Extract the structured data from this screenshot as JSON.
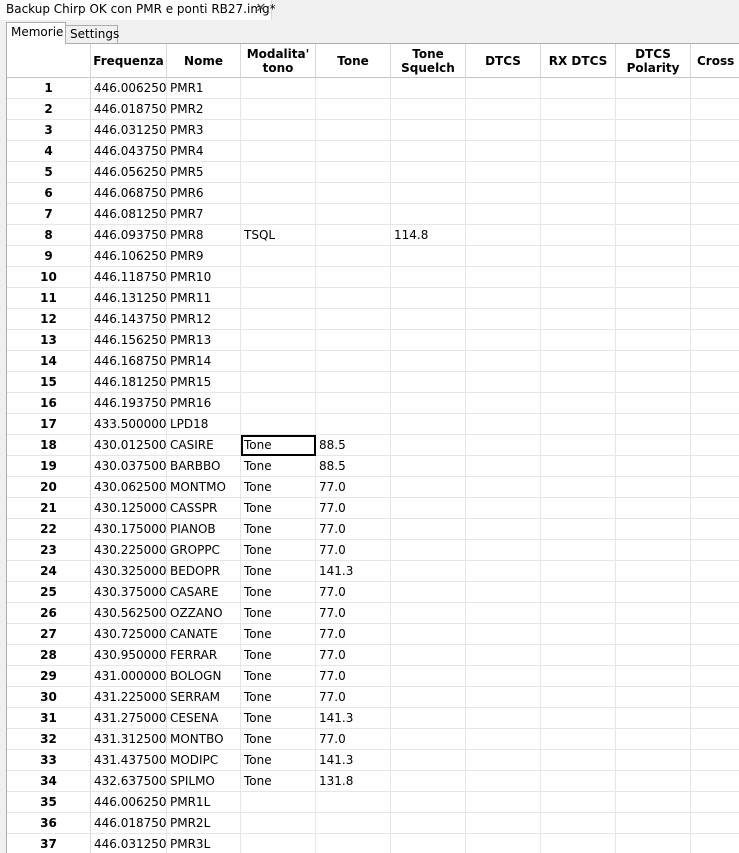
{
  "window": {
    "file_tab_title": "Backup Chirp OK con PMR e ponti RB27.img*",
    "close_glyph": "✕"
  },
  "subtabs": {
    "memories": "Memorie",
    "settings": "Settings"
  },
  "table": {
    "columns": [
      "Frequenza",
      "Nome",
      "Modalita'\ntono",
      "Tone",
      "Tone\nSquelch",
      "DTCS",
      "RX DTCS",
      "DTCS\nPolarity",
      "Cross mode"
    ],
    "selected_row": 18,
    "selected_col": 2,
    "rows": [
      {
        "n": "1",
        "freq": "446.006250",
        "name": "PMR1",
        "mode": "",
        "tone": "",
        "tsql": ""
      },
      {
        "n": "2",
        "freq": "446.018750",
        "name": "PMR2",
        "mode": "",
        "tone": "",
        "tsql": ""
      },
      {
        "n": "3",
        "freq": "446.031250",
        "name": "PMR3",
        "mode": "",
        "tone": "",
        "tsql": ""
      },
      {
        "n": "4",
        "freq": "446.043750",
        "name": "PMR4",
        "mode": "",
        "tone": "",
        "tsql": ""
      },
      {
        "n": "5",
        "freq": "446.056250",
        "name": "PMR5",
        "mode": "",
        "tone": "",
        "tsql": ""
      },
      {
        "n": "6",
        "freq": "446.068750",
        "name": "PMR6",
        "mode": "",
        "tone": "",
        "tsql": ""
      },
      {
        "n": "7",
        "freq": "446.081250",
        "name": "PMR7",
        "mode": "",
        "tone": "",
        "tsql": ""
      },
      {
        "n": "8",
        "freq": "446.093750",
        "name": "PMR8",
        "mode": "TSQL",
        "tone": "",
        "tsql": "114.8"
      },
      {
        "n": "9",
        "freq": "446.106250",
        "name": "PMR9",
        "mode": "",
        "tone": "",
        "tsql": ""
      },
      {
        "n": "10",
        "freq": "446.118750",
        "name": "PMR10",
        "mode": "",
        "tone": "",
        "tsql": ""
      },
      {
        "n": "11",
        "freq": "446.131250",
        "name": "PMR11",
        "mode": "",
        "tone": "",
        "tsql": ""
      },
      {
        "n": "12",
        "freq": "446.143750",
        "name": "PMR12",
        "mode": "",
        "tone": "",
        "tsql": ""
      },
      {
        "n": "13",
        "freq": "446.156250",
        "name": "PMR13",
        "mode": "",
        "tone": "",
        "tsql": ""
      },
      {
        "n": "14",
        "freq": "446.168750",
        "name": "PMR14",
        "mode": "",
        "tone": "",
        "tsql": ""
      },
      {
        "n": "15",
        "freq": "446.181250",
        "name": "PMR15",
        "mode": "",
        "tone": "",
        "tsql": ""
      },
      {
        "n": "16",
        "freq": "446.193750",
        "name": "PMR16",
        "mode": "",
        "tone": "",
        "tsql": ""
      },
      {
        "n": "17",
        "freq": "433.500000",
        "name": "LPD18",
        "mode": "",
        "tone": "",
        "tsql": ""
      },
      {
        "n": "18",
        "freq": "430.012500",
        "name": "CASIRE",
        "mode": "Tone",
        "tone": "88.5",
        "tsql": ""
      },
      {
        "n": "19",
        "freq": "430.037500",
        "name": "BARBBO",
        "mode": "Tone",
        "tone": "88.5",
        "tsql": ""
      },
      {
        "n": "20",
        "freq": "430.062500",
        "name": "MONTMO",
        "mode": "Tone",
        "tone": "77.0",
        "tsql": ""
      },
      {
        "n": "21",
        "freq": "430.125000",
        "name": "CASSPR",
        "mode": "Tone",
        "tone": "77.0",
        "tsql": ""
      },
      {
        "n": "22",
        "freq": "430.175000",
        "name": "PIANOB",
        "mode": "Tone",
        "tone": "77.0",
        "tsql": ""
      },
      {
        "n": "23",
        "freq": "430.225000",
        "name": "GROPPC",
        "mode": "Tone",
        "tone": "77.0",
        "tsql": ""
      },
      {
        "n": "24",
        "freq": "430.325000",
        "name": "BEDOPR",
        "mode": "Tone",
        "tone": "141.3",
        "tsql": ""
      },
      {
        "n": "25",
        "freq": "430.375000",
        "name": "CASARE",
        "mode": "Tone",
        "tone": "77.0",
        "tsql": ""
      },
      {
        "n": "26",
        "freq": "430.562500",
        "name": "OZZANO",
        "mode": "Tone",
        "tone": "77.0",
        "tsql": ""
      },
      {
        "n": "27",
        "freq": "430.725000",
        "name": "CANATE",
        "mode": "Tone",
        "tone": "77.0",
        "tsql": ""
      },
      {
        "n": "28",
        "freq": "430.950000",
        "name": "FERRAR",
        "mode": "Tone",
        "tone": "77.0",
        "tsql": ""
      },
      {
        "n": "29",
        "freq": "431.000000",
        "name": "BOLOGN",
        "mode": "Tone",
        "tone": "77.0",
        "tsql": ""
      },
      {
        "n": "30",
        "freq": "431.225000",
        "name": "SERRAM",
        "mode": "Tone",
        "tone": "77.0",
        "tsql": ""
      },
      {
        "n": "31",
        "freq": "431.275000",
        "name": "CESENA",
        "mode": "Tone",
        "tone": "141.3",
        "tsql": ""
      },
      {
        "n": "32",
        "freq": "431.312500",
        "name": "MONTBO",
        "mode": "Tone",
        "tone": "77.0",
        "tsql": ""
      },
      {
        "n": "33",
        "freq": "431.437500",
        "name": "MODIPC",
        "mode": "Tone",
        "tone": "141.3",
        "tsql": ""
      },
      {
        "n": "34",
        "freq": "432.637500",
        "name": "SPILMO",
        "mode": "Tone",
        "tone": "131.8",
        "tsql": ""
      },
      {
        "n": "35",
        "freq": "446.006250",
        "name": "PMR1L",
        "mode": "",
        "tone": "",
        "tsql": ""
      },
      {
        "n": "36",
        "freq": "446.018750",
        "name": "PMR2L",
        "mode": "",
        "tone": "",
        "tsql": ""
      },
      {
        "n": "37",
        "freq": "446.031250",
        "name": "PMR3L",
        "mode": "",
        "tone": "",
        "tsql": ""
      }
    ]
  }
}
